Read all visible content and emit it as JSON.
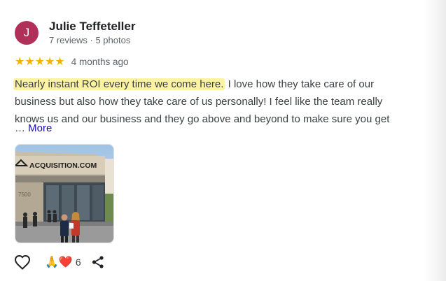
{
  "reviewer": {
    "initial": "J",
    "name": "Julie Teffeteller",
    "meta": "7 reviews · 5 photos"
  },
  "rating": {
    "stars": 5,
    "stars_text": "★★★★★",
    "time": "4 months ago"
  },
  "review": {
    "highlight": "Nearly instant ROI every time we come here.",
    "text": " I love how they take care of our business but also how they take care of us personally! I feel like the team really knows us and our business and they go above and beyond to make sure you get",
    "ellipsis": "…",
    "more_label": "More"
  },
  "photo": {
    "sign_text": "ACQUISITION.COM",
    "building_number": "7500"
  },
  "actions": {
    "like_icon": "heart-outline-icon",
    "reactions": "🙏❤️",
    "reaction_count": "6",
    "share_icon": "share-icon"
  },
  "colors": {
    "avatar": "#b0305a",
    "star": "#f4b400",
    "highlight": "#fbf3a3",
    "link": "#1a0dab"
  }
}
